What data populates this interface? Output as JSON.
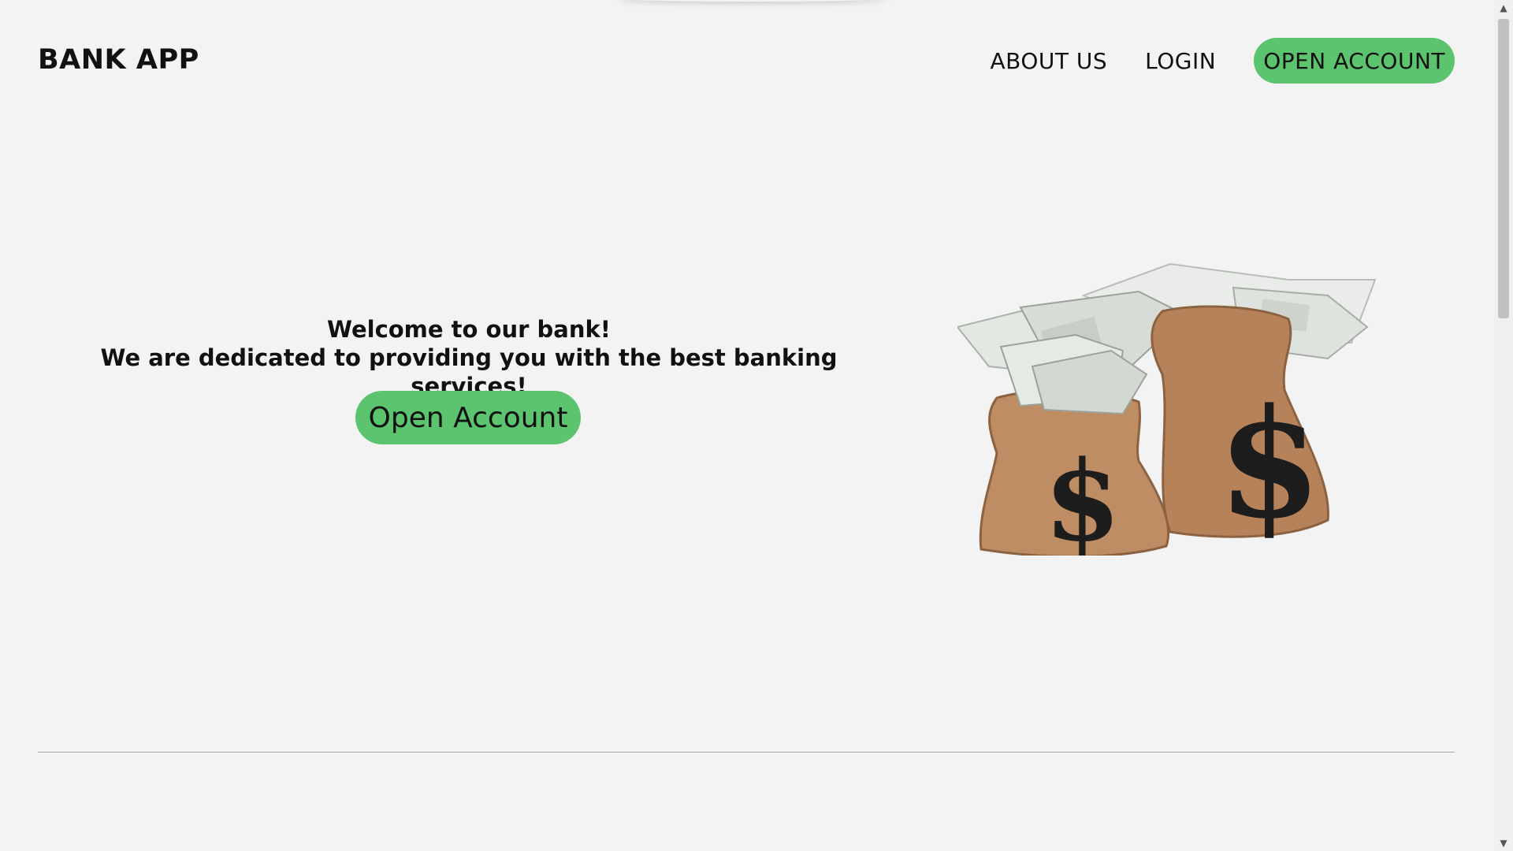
{
  "header": {
    "brand": "BANK APP",
    "nav": [
      {
        "label": "ABOUT US"
      },
      {
        "label": "LOGIN"
      }
    ],
    "cta_label": "OPEN ACCOUNT"
  },
  "hero": {
    "line1": "Welcome to our bank!",
    "line2": "We are dedicated to providing you with the best banking services!",
    "button_label": "Open Account",
    "image_icon": "money-bags-illustration"
  },
  "colors": {
    "accent": "#5cc46e",
    "background": "#f3f3f3"
  }
}
